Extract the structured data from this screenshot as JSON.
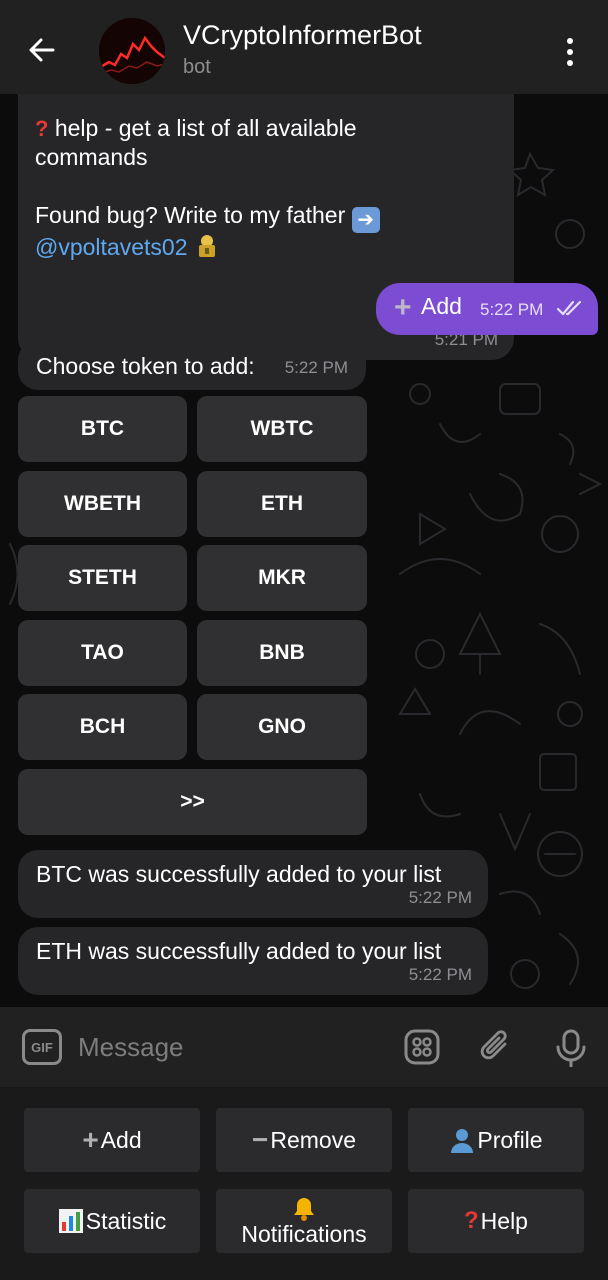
{
  "header": {
    "title": "VCryptoInformerBot",
    "subtitle": "bot"
  },
  "messages": {
    "help_line1": "help - get a list of all available",
    "help_line2": "commands",
    "bug_text": "Found bug? Write to my father",
    "bug_mention": "@vpoltavets02",
    "help_time": "5:21 PM",
    "out_text": "Add",
    "out_time": "5:22 PM",
    "choose_text": "Choose token to add:",
    "choose_time": "5:22 PM",
    "btc_added": "BTC was successfully added to your list",
    "btc_time": "5:22 PM",
    "eth_added": "ETH was successfully added to your list",
    "eth_time": "5:22 PM"
  },
  "inline_keyboard": {
    "tokens": [
      "BTC",
      "WBTC",
      "WBETH",
      "ETH",
      "STETH",
      "MKR",
      "TAO",
      "BNB",
      "BCH",
      "GNO"
    ],
    "next": ">>"
  },
  "input": {
    "gif": "GIF",
    "placeholder": "Message"
  },
  "reply_keyboard": {
    "add": "Add",
    "remove": "Remove",
    "profile": "Profile",
    "statistic": "Statistic",
    "notifications": "Notifications",
    "help": "Help"
  },
  "colors": {
    "accent_outgoing": "#7c4dd3",
    "link": "#5ea9ef",
    "bubble": "#262628"
  },
  "icons": [
    "back-arrow-icon",
    "more-vertical-icon",
    "gif-icon",
    "sticker-icon",
    "attach-icon",
    "microphone-icon",
    "read-checks-icon",
    "plus-icon",
    "minus-icon",
    "user-icon",
    "bar-chart-icon",
    "bell-icon",
    "question-icon",
    "right-arrow-icon",
    "lock-icon"
  ]
}
